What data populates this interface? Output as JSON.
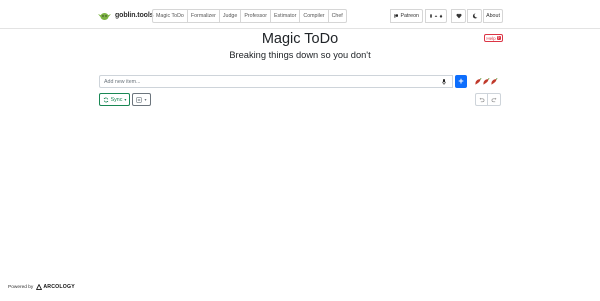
{
  "navbar": {
    "brand": "goblin.tools",
    "tools": [
      "Magic ToDo",
      "Formalizer",
      "Judge",
      "Professor",
      "Estimator",
      "Compiler",
      "Chef"
    ],
    "patreon_label": "Patreon",
    "about_label": "About"
  },
  "help_badge": {
    "label": "Help",
    "icon": "?"
  },
  "page": {
    "title": "Magic ToDo",
    "subtitle": "Breaking things down so you don't"
  },
  "add_item": {
    "placeholder": "Add new item...",
    "add_button": "+"
  },
  "toolbar": {
    "sync_label": "Sync",
    "sync_caret": "▾",
    "filter_caret": "▾"
  },
  "footer": {
    "powered_by": "Powered by",
    "company": "ARCOLOGY"
  },
  "colors": {
    "primary": "#0d6efd",
    "success": "#198754",
    "danger": "#dc3545",
    "spice": "#c0392b",
    "brand_green": "#7cb342"
  }
}
